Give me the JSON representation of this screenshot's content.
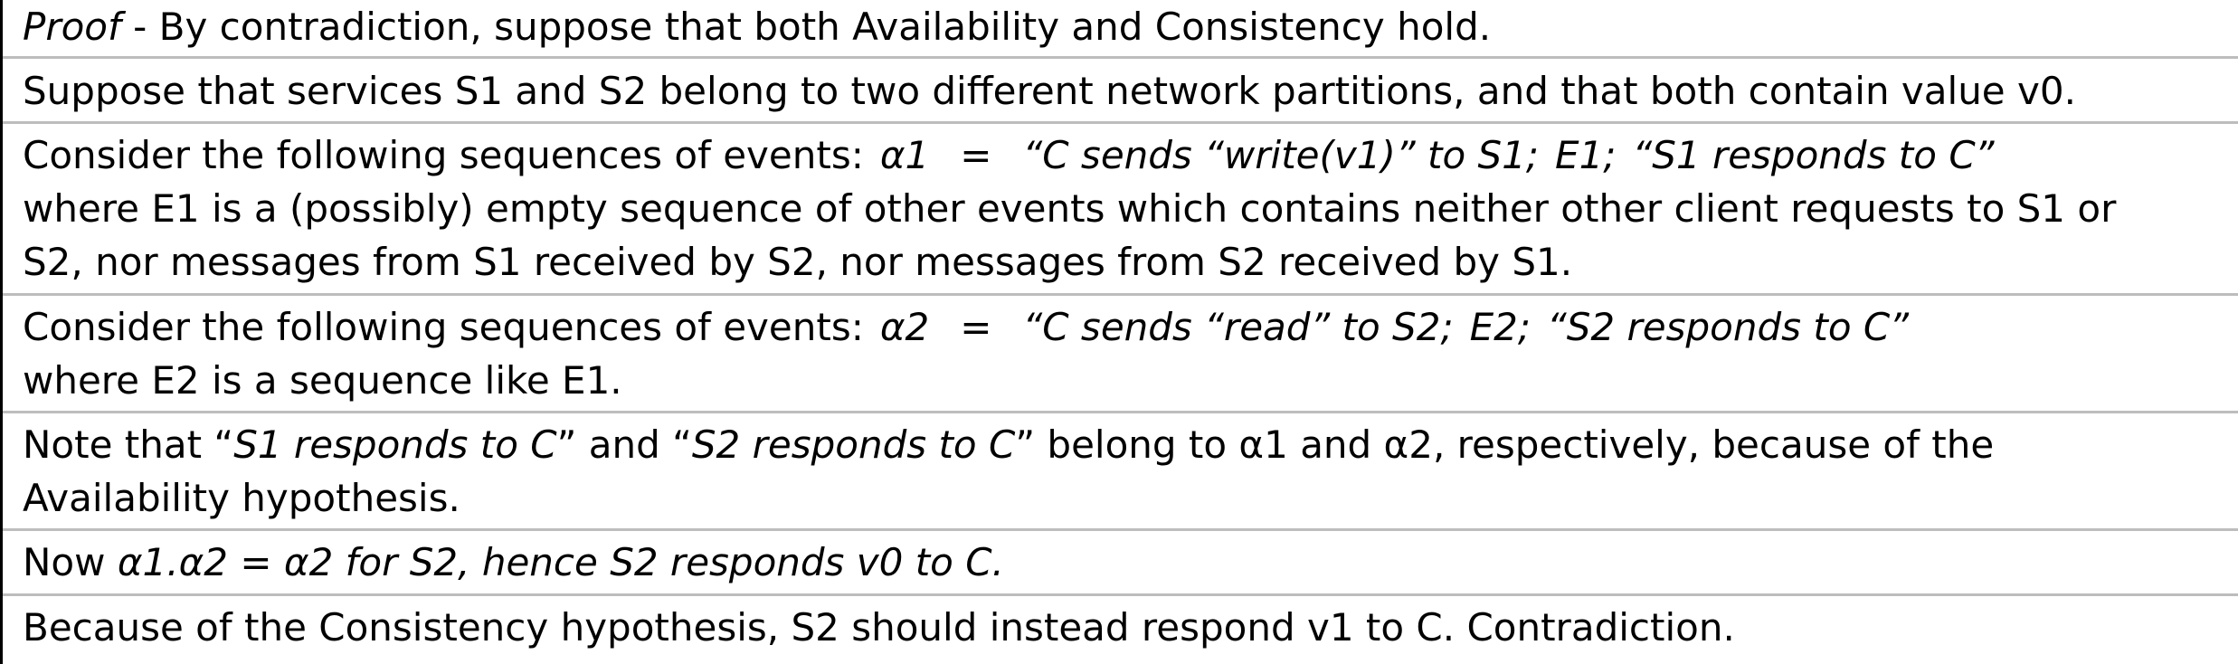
{
  "p1": {
    "proof_word": "Proof",
    "text": " - By contradiction, suppose that both Availability and Consistency hold."
  },
  "p2": {
    "text": "Suppose that services S1 and S2 belong to two different network partitions, and that both contain value v0."
  },
  "p3": {
    "lead": "Consider the following sequences of events:",
    "seq_name": "α1",
    "eq": "=",
    "ev1": "“C sends “write(v1)” to S1;",
    "ev2": "E1;",
    "ev3": "“S1 responds to C”",
    "line2": "where E1 is a (possibly) empty sequence of other events which contains neither other client requests to S1 or",
    "line3": "S2, nor messages from S1 received by S2, nor messages from S2 received by S1."
  },
  "p4": {
    "lead": "Consider the following sequences of events:",
    "seq_name": "α2",
    "eq": "=",
    "ev1": "“C sends “read” to S2;",
    "ev2": "E2;",
    "ev3": "“S2 responds to C”",
    "line2": "where E2 is a sequence like E1."
  },
  "p5": {
    "t1": "Note that “",
    "i1": "S1 responds to C",
    "t2": "” and “",
    "i2": "S2 responds to C",
    "t3": "” belong to α1 and α2, respectively, because of the",
    "line2": "Availability hypothesis."
  },
  "p6": {
    "t1": "Now ",
    "i1": "α1.α2 = α2 for S2, hence S2 responds v0 to C."
  },
  "p7": {
    "text": "Because of the Consistency hypothesis, S2 should instead respond v1 to C. Contradiction."
  }
}
